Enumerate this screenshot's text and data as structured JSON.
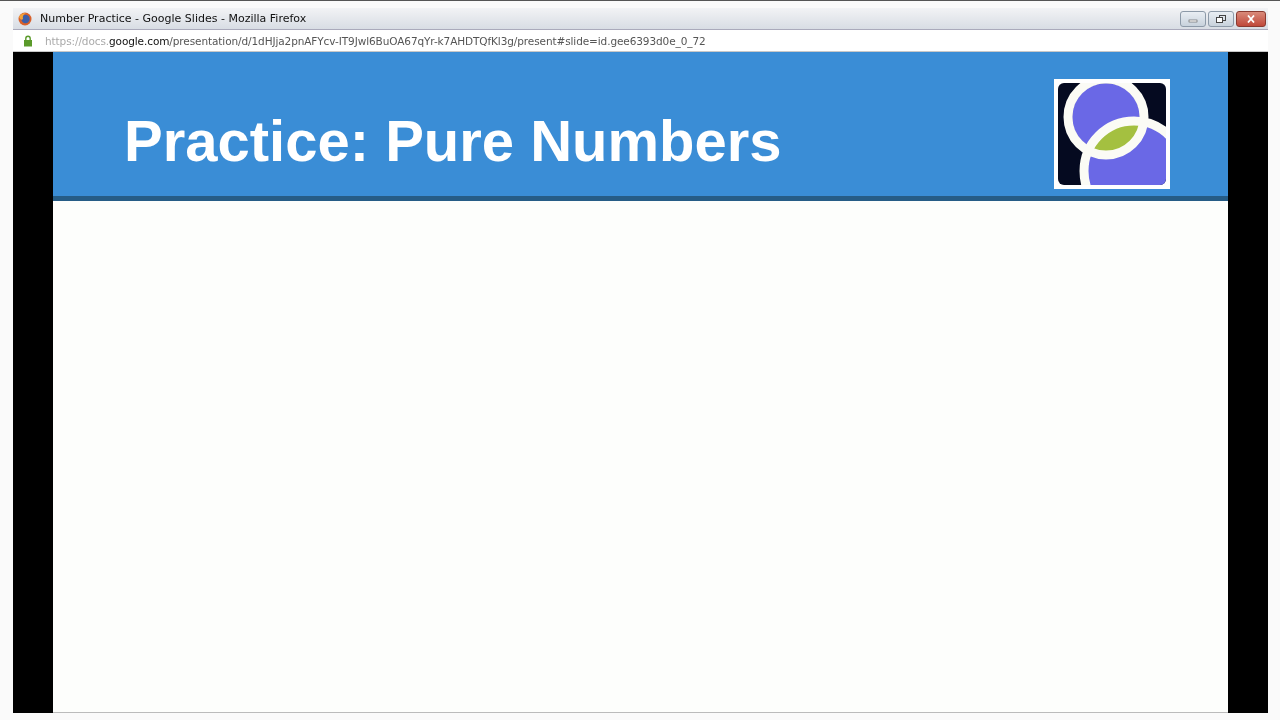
{
  "window": {
    "title": "Number Practice - Google Slides - Mozilla Firefox"
  },
  "address_bar": {
    "url_prefix": "https://docs.",
    "url_domain": "google.com",
    "url_path": "/presentation/d/1dHJja2pnAFYcv-IT9Jwl6BuOA67qYr-k7AHDTQfKl3g/present#slide=id.gee6393d0e_0_72"
  },
  "slide": {
    "title": "Practice: Pure Numbers"
  }
}
